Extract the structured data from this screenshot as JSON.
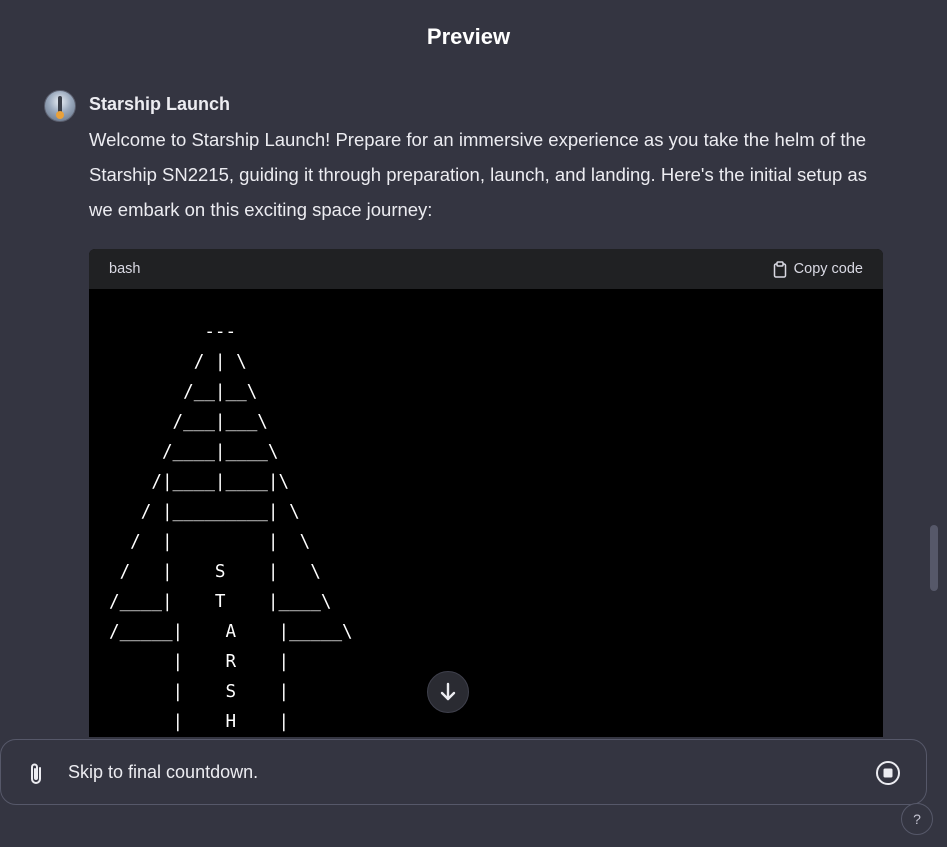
{
  "header": {
    "title": "Preview"
  },
  "message": {
    "sender": "Starship Launch",
    "avatar_icon": "rocket-launch-avatar",
    "text": "Welcome to Starship Launch! Prepare for an immersive experience as you take the helm of the Starship SN2215, guiding it through preparation, launch, and landing. Here's the initial setup as we embark on this exciting space journey:",
    "code": {
      "language": "bash",
      "copy_label": "Copy code",
      "content": "         ---\n        / | \\\n       /__|__\\\n      /___|___\\\n     /____|____\\\n    /|____|____|\\\n   / |_________| \\\n  /  |         |  \\\n /   |    S    |   \\\n/____|    T    |____\\\n/_____|    A    |_____\\\n      |    R    |\n      |    S    |\n      |    H    |"
    }
  },
  "composer": {
    "value": "Skip to final countdown.",
    "attach_icon": "paperclip-icon",
    "stop_icon": "stop-icon"
  },
  "help": {
    "label": "?"
  },
  "colors": {
    "background": "#343541",
    "code_background": "#000000",
    "code_header": "#202123",
    "text": "#ececf1"
  }
}
